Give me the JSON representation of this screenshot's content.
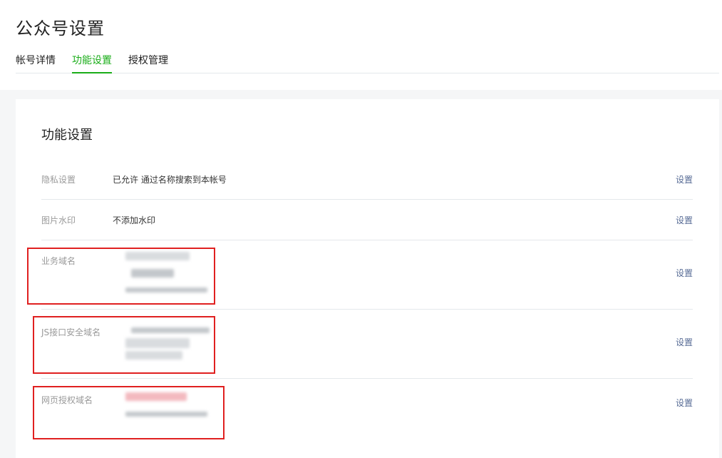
{
  "page": {
    "title": "公众号设置"
  },
  "tabs": [
    {
      "label": "帐号详情",
      "active": false
    },
    {
      "label": "功能设置",
      "active": true
    },
    {
      "label": "授权管理",
      "active": false
    }
  ],
  "section": {
    "title": "功能设置",
    "rows": [
      {
        "label": "隐私设置",
        "value": "已允许 通过名称搜索到本帐号",
        "action": "设置"
      },
      {
        "label": "图片水印",
        "value": "不添加水印",
        "action": "设置"
      },
      {
        "label": "业务域名",
        "value": "",
        "action": "设置"
      },
      {
        "label": "JS接口安全域名",
        "value": "",
        "action": "设置"
      },
      {
        "label": "网页授权域名",
        "value": "",
        "action": "设置"
      }
    ]
  },
  "colors": {
    "accent_green": "#1aad19",
    "link_blue": "#576b95",
    "annotation_red": "#e02020"
  }
}
